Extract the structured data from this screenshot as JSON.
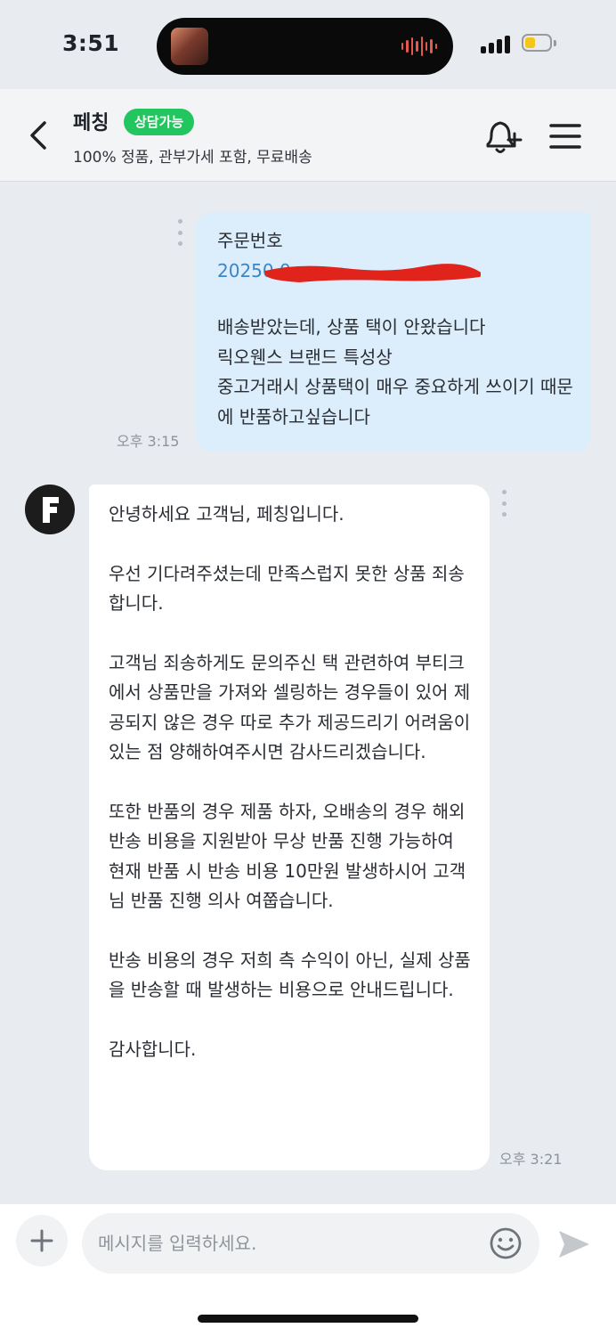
{
  "status_bar": {
    "time": "3:51"
  },
  "header": {
    "shop_name": "페칭",
    "status_badge": "상담가능",
    "description": "100% 정품, 관부가세 포함, 무료배송"
  },
  "messages": {
    "outgoing": {
      "title": "주문번호",
      "order_number": "20250   0      ",
      "body": "배송받았는데, 상품 택이 안왔습니다\n릭오웬스 브랜드 특성상\n중고거래시 상품택이 매우 중요하게 쓰이기 때문에 반품하고싶습니다",
      "time": "오후 3:15"
    },
    "incoming": {
      "sender_initial": "F",
      "paragraphs": [
        "안녕하세요 고객님, 페칭입니다.",
        "우선 기다려주셨는데 만족스럽지 못한 상품 죄송합니다.",
        "고객님 죄송하게도 문의주신 택 관련하여 부티크에서 상품만을 가져와 셀링하는 경우들이 있어 제공되지 않은 경우 따로 추가 제공드리기 어려움이 있는 점 양해하여주시면 감사드리겠습니다.",
        "또한 반품의 경우 제품 하자, 오배송의 경우 해외 반송 비용을 지원받아 무상 반품 진행 가능하여 현재 반품 시 반송 비용 10만원 발생하시어 고객님 반품 진행 의사 여쭙습니다.",
        "반송 비용의 경우 저희 측 수익이 아닌, 실제 상품을 반송할 때 발생하는 비용으로 안내드립니다.",
        "감사합니다."
      ],
      "time": "오후 3:21"
    }
  },
  "input_bar": {
    "placeholder": "메시지를 입력하세요."
  },
  "colors": {
    "badge_green": "#23c55e",
    "outgoing_bubble": "#dcedfb",
    "link_blue": "#3a86c8",
    "redaction_red": "#e0241b"
  }
}
